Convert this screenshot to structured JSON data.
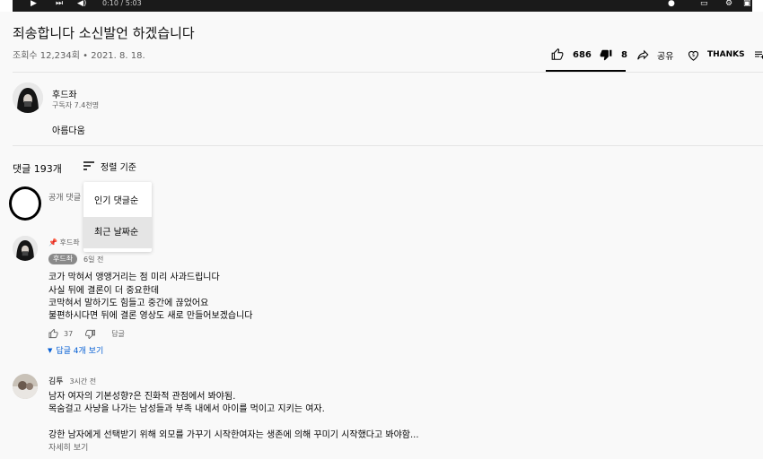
{
  "player": {
    "time": "0:10 / 5:03"
  },
  "video": {
    "title": "죄송합니다 소신발언 하겠습니다",
    "meta": "조회수 12,234회 • 2021. 8. 18.",
    "likes": "686",
    "dislikes": "8",
    "share_label": "공유",
    "thanks_label": "THANKS"
  },
  "channel": {
    "name": "후드좌",
    "subscribers": "구독자 7.4천명",
    "description": "아름다움"
  },
  "comments_header": {
    "count": "댓글 193개",
    "sort_label": "정렬 기준"
  },
  "add_comment": {
    "placeholder": "공개 댓글"
  },
  "sort_menu": {
    "items": [
      "인기 댓글순",
      "최근 날짜순"
    ],
    "selected": "최근 날짜순"
  },
  "comments": [
    {
      "pinned_text": "후드좌",
      "author_badge": "후드좌",
      "time": "6일 전",
      "lines": [
        "코가 막혀서 앵앵거리는 점 미리 사과드립니다",
        "사실 뒤에 결론이 더 중요한데",
        "코막혀서 말하기도 힘들고 중간에 끊었어요",
        "불편하시다면 뒤에 결론 영상도 새로 만들어보겠습니다"
      ],
      "likes": "37",
      "reply_label": "답글",
      "view_replies": "답글 4개 보기"
    },
    {
      "author": "김투",
      "time": "3시간 전",
      "lines": [
        "남자 여자의 기본성향?은 진화적 관점에서 봐야됨.",
        "목숨걸고 사냥을 나가는 남성들과 부족 내에서 아이를 먹이고 지키는 여자.",
        "",
        "강한 남자에게 선택받기 위해 외모를 가꾸기 시작한여자는 생존에 의해 꾸미기 시작했다고 봐야함..."
      ],
      "read_more": "자세히 보기"
    }
  ]
}
